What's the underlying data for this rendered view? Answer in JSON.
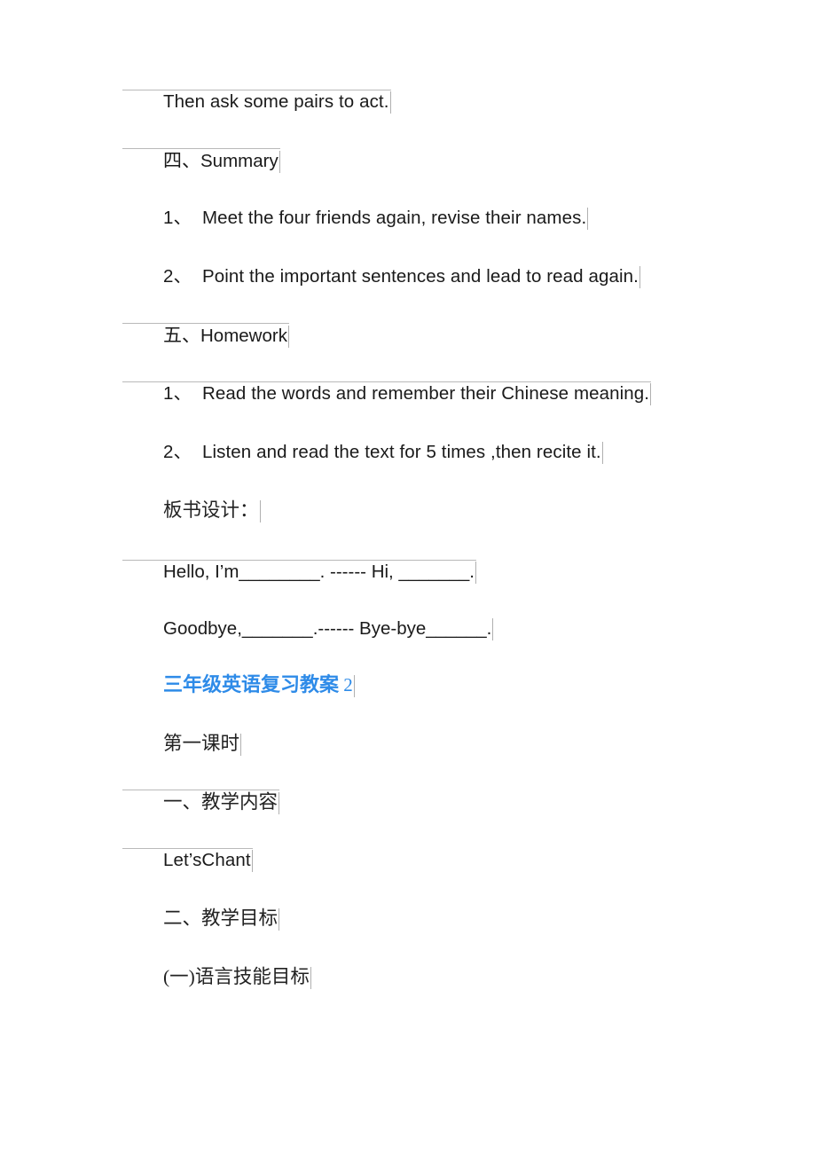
{
  "document": {
    "page_background": "#ffffff",
    "text_color": "#1a1a1a",
    "accent_color": "#2E8BE8",
    "rule_color": "#b9b9b9"
  },
  "paragraphs": [
    {
      "id": "p1",
      "kind": "en",
      "ruled": true,
      "text": "Then ask some pairs to act."
    },
    {
      "id": "p2",
      "kind": "mix",
      "ruled": true,
      "cjk": "四、",
      "latin": "Summary"
    },
    {
      "id": "p3",
      "kind": "numbered",
      "ruled": false,
      "marker": "1、",
      "text": "Meet the four friends again, revise their names."
    },
    {
      "id": "p4",
      "kind": "numbered",
      "ruled": false,
      "marker": "2、",
      "text": "Point the important sentences and lead to read again."
    },
    {
      "id": "p5",
      "kind": "mix",
      "ruled": true,
      "cjk": "五、",
      "latin": "Homework"
    },
    {
      "id": "p6",
      "kind": "numbered",
      "ruled": true,
      "marker": "1、",
      "text": "Read the words and remember their Chinese meaning."
    },
    {
      "id": "p7",
      "kind": "numbered",
      "ruled": false,
      "marker": "2、",
      "text": "Listen and read the text for 5 times ,then recite it."
    },
    {
      "id": "p8",
      "kind": "cjk",
      "ruled": false,
      "text": "板书设计："
    },
    {
      "id": "p9",
      "kind": "en",
      "ruled": true,
      "text": "Hello, I’m________. ------ Hi, _______."
    },
    {
      "id": "p10",
      "kind": "en",
      "ruled": false,
      "text": "Goodbye,_______.------ Bye-bye______."
    },
    {
      "id": "p11",
      "kind": "heading",
      "ruled": false,
      "text": "三年级英语复习教案",
      "number": "2"
    },
    {
      "id": "p12",
      "kind": "cjk",
      "ruled": false,
      "text": "第一课时"
    },
    {
      "id": "p13",
      "kind": "cjk",
      "ruled": true,
      "text": "一、教学内容"
    },
    {
      "id": "p14",
      "kind": "en",
      "ruled": true,
      "text": "Let’sChant"
    },
    {
      "id": "p15",
      "kind": "cjk",
      "ruled": false,
      "text": "二、教学目标"
    },
    {
      "id": "p16",
      "kind": "cjk",
      "ruled": false,
      "text": "(一)语言技能目标"
    }
  ]
}
